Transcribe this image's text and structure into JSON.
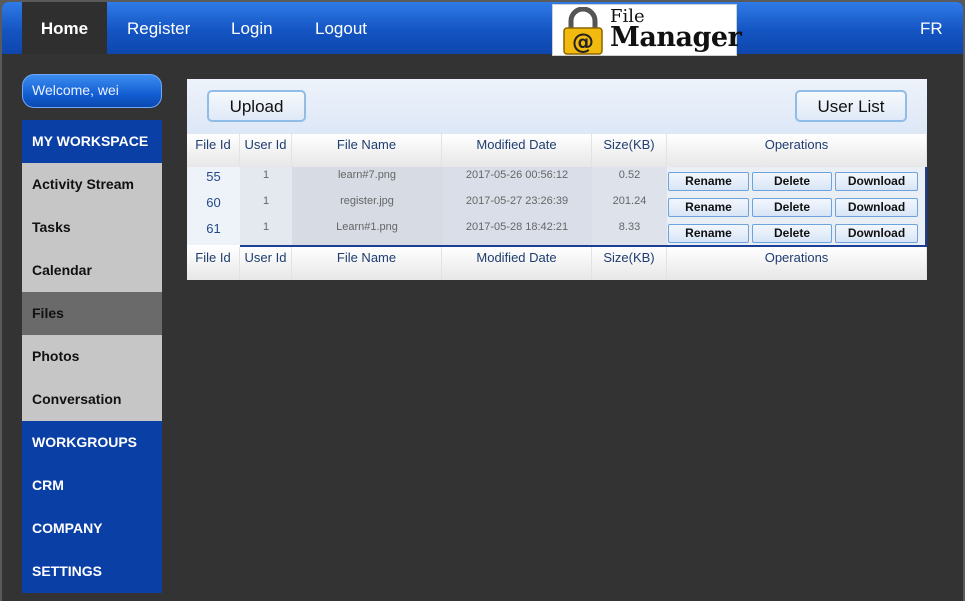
{
  "nav": {
    "home": "Home",
    "register": "Register",
    "login": "Login",
    "logout": "Logout",
    "lang": "FR"
  },
  "logo": {
    "line1": "File",
    "line2": "Manager"
  },
  "sidebar": {
    "welcome": "Welcome, wei",
    "items": [
      {
        "label": "MY WORKSPACE",
        "style": "blue"
      },
      {
        "label": "Activity Stream",
        "style": "grey"
      },
      {
        "label": "Tasks",
        "style": "grey"
      },
      {
        "label": "Calendar",
        "style": "grey"
      },
      {
        "label": "Files",
        "style": "active"
      },
      {
        "label": "Photos",
        "style": "grey"
      },
      {
        "label": "Conversation",
        "style": "grey"
      },
      {
        "label": "WORKGROUPS",
        "style": "blue"
      },
      {
        "label": "CRM",
        "style": "blue"
      },
      {
        "label": "COMPANY",
        "style": "blue"
      },
      {
        "label": "SETTINGS",
        "style": "blue"
      }
    ]
  },
  "toolbar": {
    "upload": "Upload",
    "user_list": "User List"
  },
  "table": {
    "columns": [
      "File Id",
      "User Id",
      "File Name",
      "Modified Date",
      "Size(KB)",
      "Operations"
    ],
    "rows": [
      {
        "file_id": "55",
        "user_id": "1",
        "file_name": "learn#7.png",
        "modified": "2017-05-26 00:56:12",
        "size": "0.52"
      },
      {
        "file_id": "60",
        "user_id": "1",
        "file_name": "register.jpg",
        "modified": "2017-05-27 23:26:39",
        "size": "201.24"
      },
      {
        "file_id": "61",
        "user_id": "1",
        "file_name": "Learn#1.png",
        "modified": "2017-05-28 18:42:21",
        "size": "8.33"
      }
    ],
    "operations": {
      "rename": "Rename",
      "delete": "Delete",
      "download": "Download"
    }
  },
  "colors": {
    "nav_blue": "#1455c2",
    "sidebar_blue": "#0a3fa6",
    "sidebar_grey": "#c6c6c6",
    "sidebar_active": "#6a6a6a",
    "background": "#333333"
  }
}
